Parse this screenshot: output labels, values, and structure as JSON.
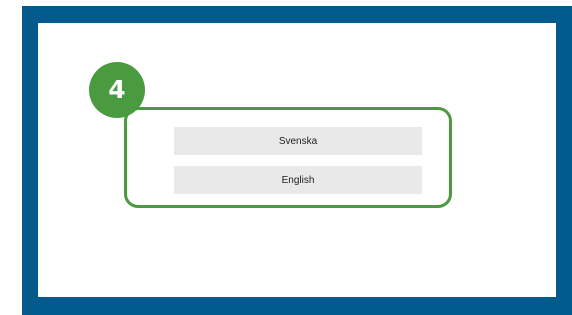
{
  "step": {
    "number": "4",
    "color": "#4a9a3f"
  },
  "frame": {
    "border_color": "#035a8c"
  },
  "language_options": [
    {
      "label": "Svenska"
    },
    {
      "label": "English"
    }
  ]
}
